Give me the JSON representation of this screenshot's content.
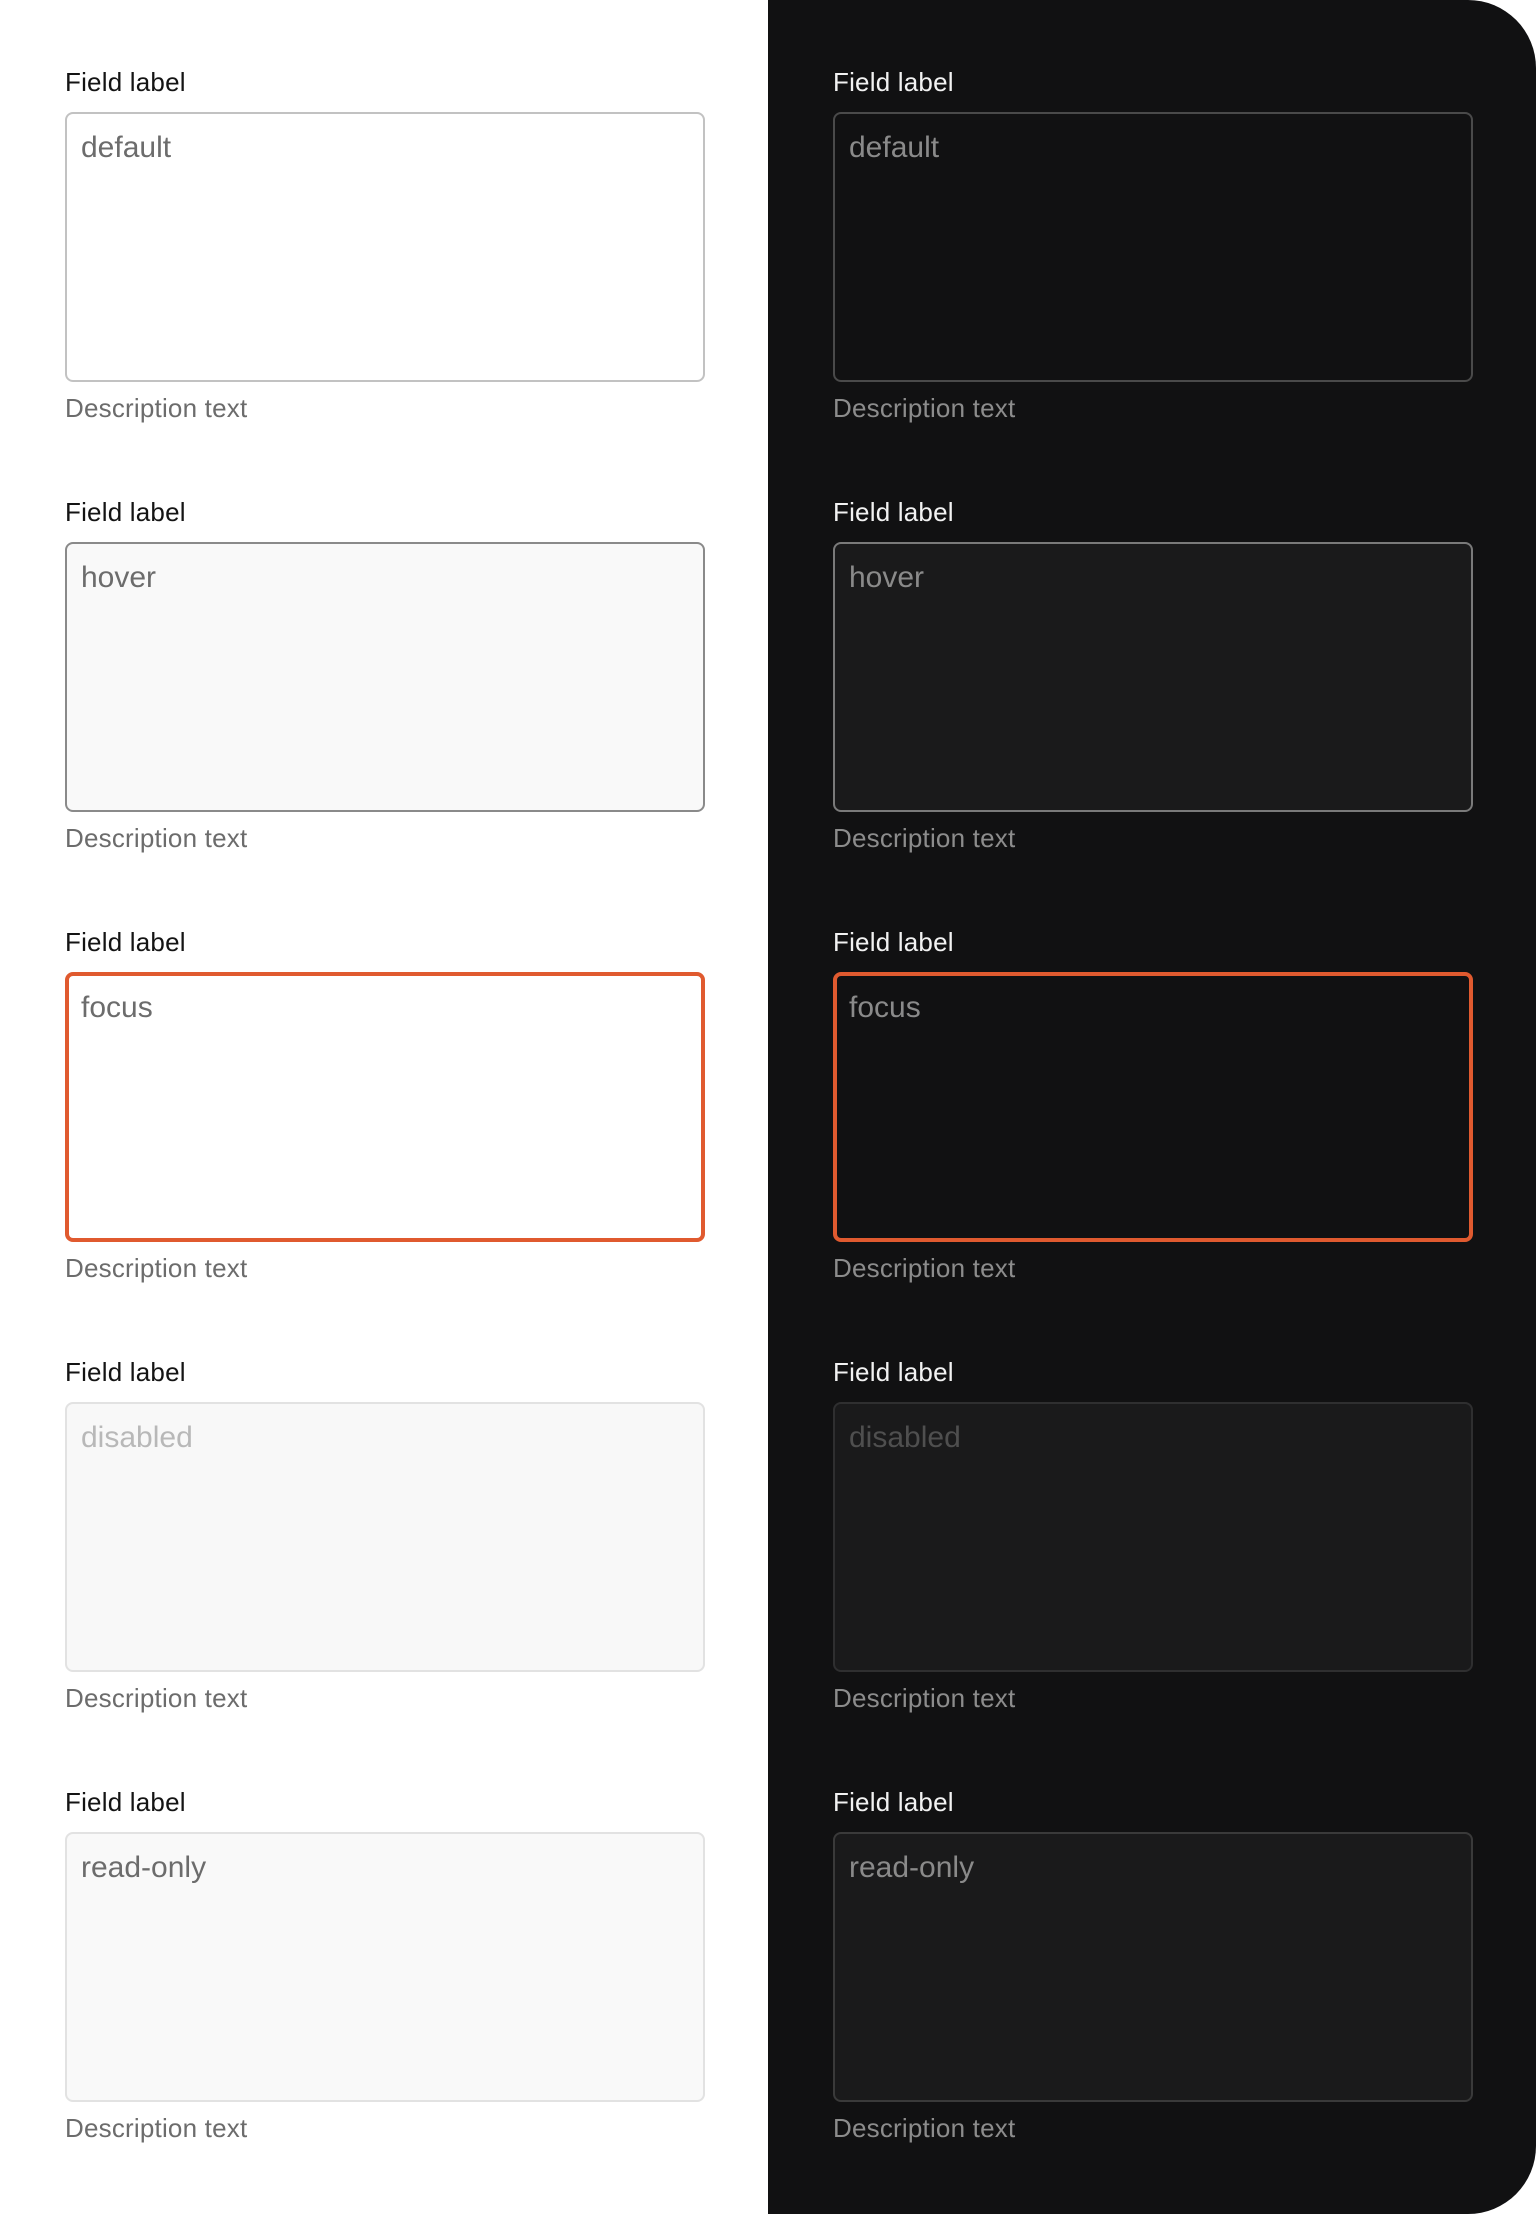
{
  "colors": {
    "focus_accent": "#e05a2f",
    "dark_background": "#111112",
    "light_background": "#ffffff"
  },
  "light": {
    "fields": [
      {
        "label": "Field label",
        "value": "default",
        "description": "Description text",
        "state": "default"
      },
      {
        "label": "Field label",
        "value": "hover",
        "description": "Description text",
        "state": "hover"
      },
      {
        "label": "Field label",
        "value": "focus",
        "description": "Description text",
        "state": "focus"
      },
      {
        "label": "Field label",
        "value": "disabled",
        "description": "Description text",
        "state": "disabled"
      },
      {
        "label": "Field label",
        "value": "read-only",
        "description": "Description text",
        "state": "read-only"
      }
    ]
  },
  "dark": {
    "fields": [
      {
        "label": "Field label",
        "value": "default",
        "description": "Description text",
        "state": "default"
      },
      {
        "label": "Field label",
        "value": "hover",
        "description": "Description text",
        "state": "hover"
      },
      {
        "label": "Field label",
        "value": "focus",
        "description": "Description text",
        "state": "focus"
      },
      {
        "label": "Field label",
        "value": "disabled",
        "description": "Description text",
        "state": "disabled"
      },
      {
        "label": "Field label",
        "value": "read-only",
        "description": "Description text",
        "state": "read-only"
      }
    ]
  }
}
